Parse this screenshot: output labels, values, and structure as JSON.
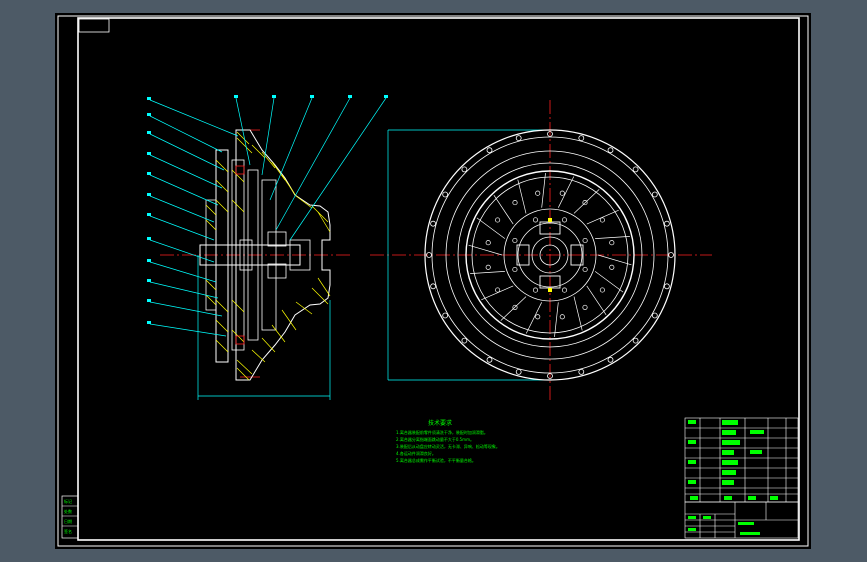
{
  "colors": {
    "background_outer": "#4d5a66",
    "sheet": "#000000",
    "line": "#ffffff",
    "hatch": "#ffff00",
    "centerline": "#ff2020",
    "leader": "#00ffff",
    "dimension": "#00ffff",
    "notes": "#00ff00"
  },
  "notes": {
    "title": "技术要求",
    "lines": [
      "1.离合器装配前零件须清洗干净，装配时加润滑脂。",
      "2.离合器分离指端面跳动量不大于0.5mm。",
      "3.装配后从动盘应转动灵活，无卡滞、异响、松动等现象。",
      "4.各运动件润滑良好。",
      "5.离合器总成需作平衡试验，不平衡量合格。"
    ]
  },
  "side_labels": [
    "标记",
    "处数",
    "日期",
    "签名"
  ]
}
